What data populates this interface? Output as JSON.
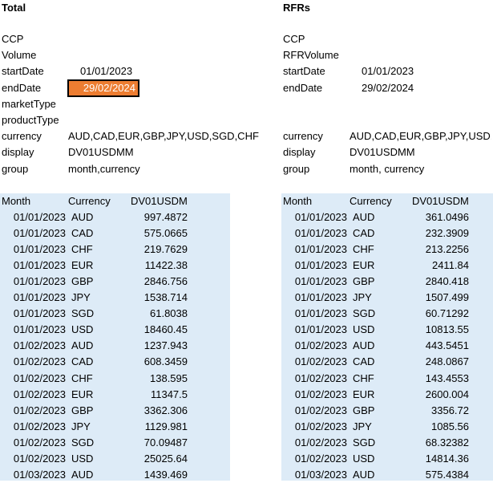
{
  "left": {
    "title": "Total",
    "params": [
      {
        "label": "CCP",
        "value": ""
      },
      {
        "label": "Volume",
        "value": ""
      },
      {
        "label": "startDate",
        "value": "01/01/2023"
      },
      {
        "label": "endDate",
        "value": "29/02/2024"
      },
      {
        "label": "marketType",
        "value": ""
      },
      {
        "label": "productType",
        "value": ""
      },
      {
        "label": "currency",
        "value": "AUD,CAD,EUR,GBP,JPY,USD,SGD,CHF"
      },
      {
        "label": "display",
        "value": "DV01USDMM"
      },
      {
        "label": "group",
        "value": "month,currency"
      }
    ],
    "headers": [
      "Month",
      "Currency",
      "DV01USDM"
    ],
    "rows": [
      [
        "01/01/2023",
        "AUD",
        "997.4872"
      ],
      [
        "01/01/2023",
        "CAD",
        "575.0665"
      ],
      [
        "01/01/2023",
        "CHF",
        "219.7629"
      ],
      [
        "01/01/2023",
        "EUR",
        "11422.38"
      ],
      [
        "01/01/2023",
        "GBP",
        "2846.756"
      ],
      [
        "01/01/2023",
        "JPY",
        "1538.714"
      ],
      [
        "01/01/2023",
        "SGD",
        "61.8038"
      ],
      [
        "01/01/2023",
        "USD",
        "18460.45"
      ],
      [
        "01/02/2023",
        "AUD",
        "1237.943"
      ],
      [
        "01/02/2023",
        "CAD",
        "608.3459"
      ],
      [
        "01/02/2023",
        "CHF",
        "138.595"
      ],
      [
        "01/02/2023",
        "EUR",
        "11347.5"
      ],
      [
        "01/02/2023",
        "GBP",
        "3362.306"
      ],
      [
        "01/02/2023",
        "JPY",
        "1129.981"
      ],
      [
        "01/02/2023",
        "SGD",
        "70.09487"
      ],
      [
        "01/02/2023",
        "USD",
        "25025.64"
      ],
      [
        "01/03/2023",
        "AUD",
        "1439.469"
      ]
    ]
  },
  "right": {
    "title": "RFRs",
    "params": [
      {
        "label": "CCP",
        "value": ""
      },
      {
        "label": "RFRVolume",
        "value": ""
      },
      {
        "label": "startDate",
        "value": "01/01/2023"
      },
      {
        "label": "endDate",
        "value": "29/02/2024"
      },
      {
        "label": "",
        "value": ""
      },
      {
        "label": "",
        "value": ""
      },
      {
        "label": "currency",
        "value": "AUD,CAD,EUR,GBP,JPY,USD,SGD,CHF"
      },
      {
        "label": "display",
        "value": "DV01USDMM"
      },
      {
        "label": "group",
        "value": "month, currency"
      }
    ],
    "headers": [
      "Month",
      "Currency",
      "DV01USDM"
    ],
    "rows": [
      [
        "01/01/2023",
        "AUD",
        "361.0496"
      ],
      [
        "01/01/2023",
        "CAD",
        "232.3909"
      ],
      [
        "01/01/2023",
        "CHF",
        "213.2256"
      ],
      [
        "01/01/2023",
        "EUR",
        "2411.84"
      ],
      [
        "01/01/2023",
        "GBP",
        "2840.418"
      ],
      [
        "01/01/2023",
        "JPY",
        "1507.499"
      ],
      [
        "01/01/2023",
        "SGD",
        "60.71292"
      ],
      [
        "01/01/2023",
        "USD",
        "10813.55"
      ],
      [
        "01/02/2023",
        "AUD",
        "443.5451"
      ],
      [
        "01/02/2023",
        "CAD",
        "248.0867"
      ],
      [
        "01/02/2023",
        "CHF",
        "143.4553"
      ],
      [
        "01/02/2023",
        "EUR",
        "2600.004"
      ],
      [
        "01/02/2023",
        "GBP",
        "3356.72"
      ],
      [
        "01/02/2023",
        "JPY",
        "1085.56"
      ],
      [
        "01/02/2023",
        "SGD",
        "68.32382"
      ],
      [
        "01/02/2023",
        "USD",
        "14814.36"
      ],
      [
        "01/03/2023",
        "AUD",
        "575.4384"
      ]
    ]
  },
  "colors": {
    "table_bg": "#ddebf7",
    "selected_cell_bg": "#ed7d31"
  }
}
